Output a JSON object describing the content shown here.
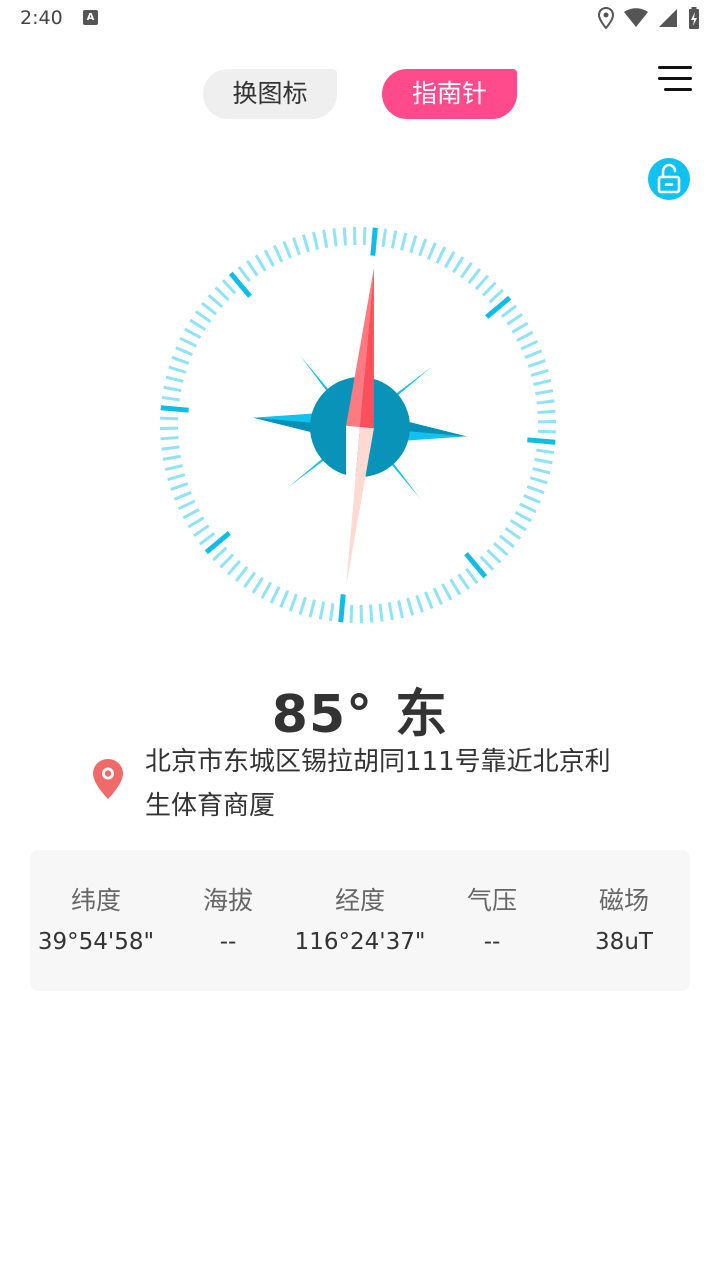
{
  "status_bar": {
    "time": "2:40",
    "notification_icon": "A",
    "icons": [
      "location-icon",
      "wifi-icon",
      "signal-icon",
      "battery-charging-icon"
    ]
  },
  "tabs": [
    {
      "label": "换图标",
      "active": false
    },
    {
      "label": "指南针",
      "active": true
    }
  ],
  "colors": {
    "accent_pink": "#ff4b8b",
    "compass_blue": "#10c2ef",
    "needle_red": "#ff5a64",
    "pin_red": "#f06a6a"
  },
  "compass": {
    "heading": {
      "degrees": "85°",
      "direction": "东"
    }
  },
  "location": {
    "address": "北京市东城区锡拉胡同111号靠近北京利生体育商厦"
  },
  "stats": [
    {
      "label": "纬度",
      "value": "39°54'58\""
    },
    {
      "label": "海拔",
      "value": "--"
    },
    {
      "label": "经度",
      "value": "116°24'37\""
    },
    {
      "label": "气压",
      "value": "--"
    },
    {
      "label": "磁场",
      "value": "38uT"
    }
  ]
}
